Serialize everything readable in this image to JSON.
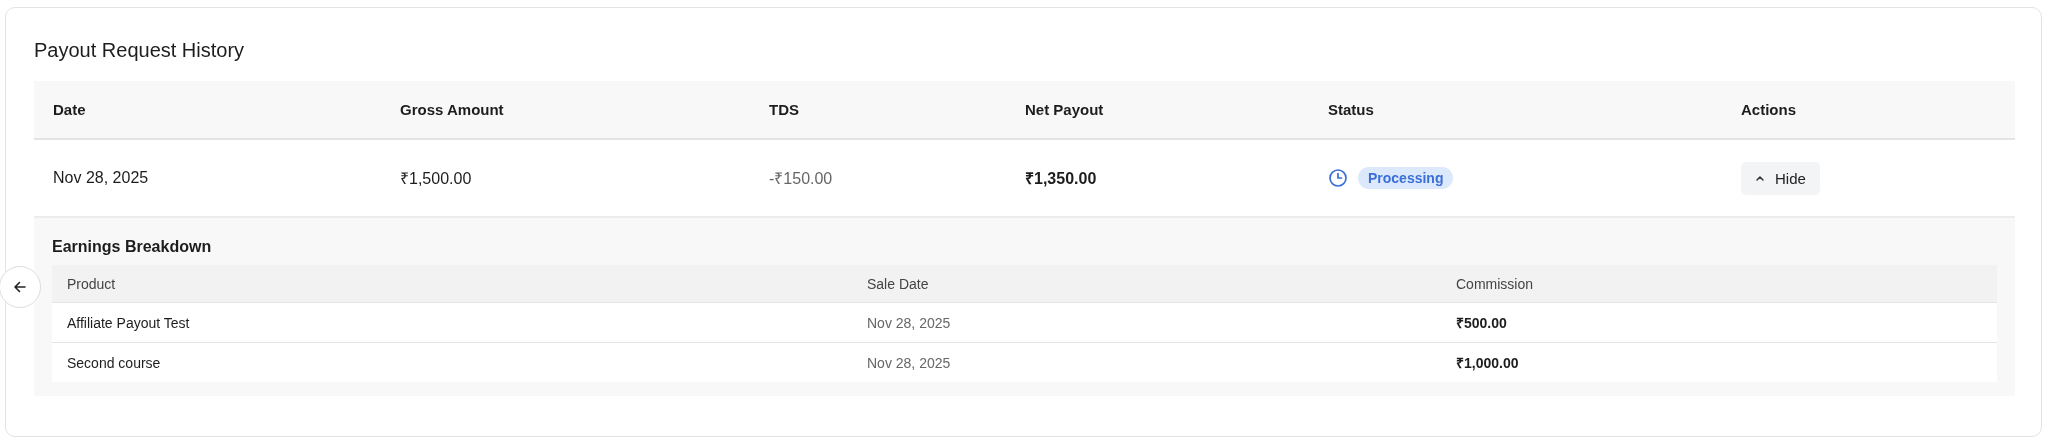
{
  "title": "Payout Request History",
  "table": {
    "columns": [
      "Date",
      "Gross Amount",
      "TDS",
      "Net Payout",
      "Status",
      "Actions"
    ],
    "rows": [
      {
        "date": "Nov 28, 2025",
        "gross": "₹1,500.00",
        "tds": "-₹150.00",
        "net": "₹1,350.00",
        "status": {
          "kind": "processing",
          "label": "Processing"
        },
        "action": {
          "label": "Hide",
          "expanded": true
        },
        "breakdown": {
          "title": "Earnings Breakdown",
          "columns": [
            "Product",
            "Sale Date",
            "Commission"
          ],
          "rows": [
            {
              "product": "Affiliate Payout Test",
              "sale_date": "Nov 28, 2025",
              "commission": "₹500.00"
            },
            {
              "product": "Second course",
              "sale_date": "Nov 28, 2025",
              "commission": "₹1,000.00"
            }
          ]
        }
      }
    ]
  }
}
